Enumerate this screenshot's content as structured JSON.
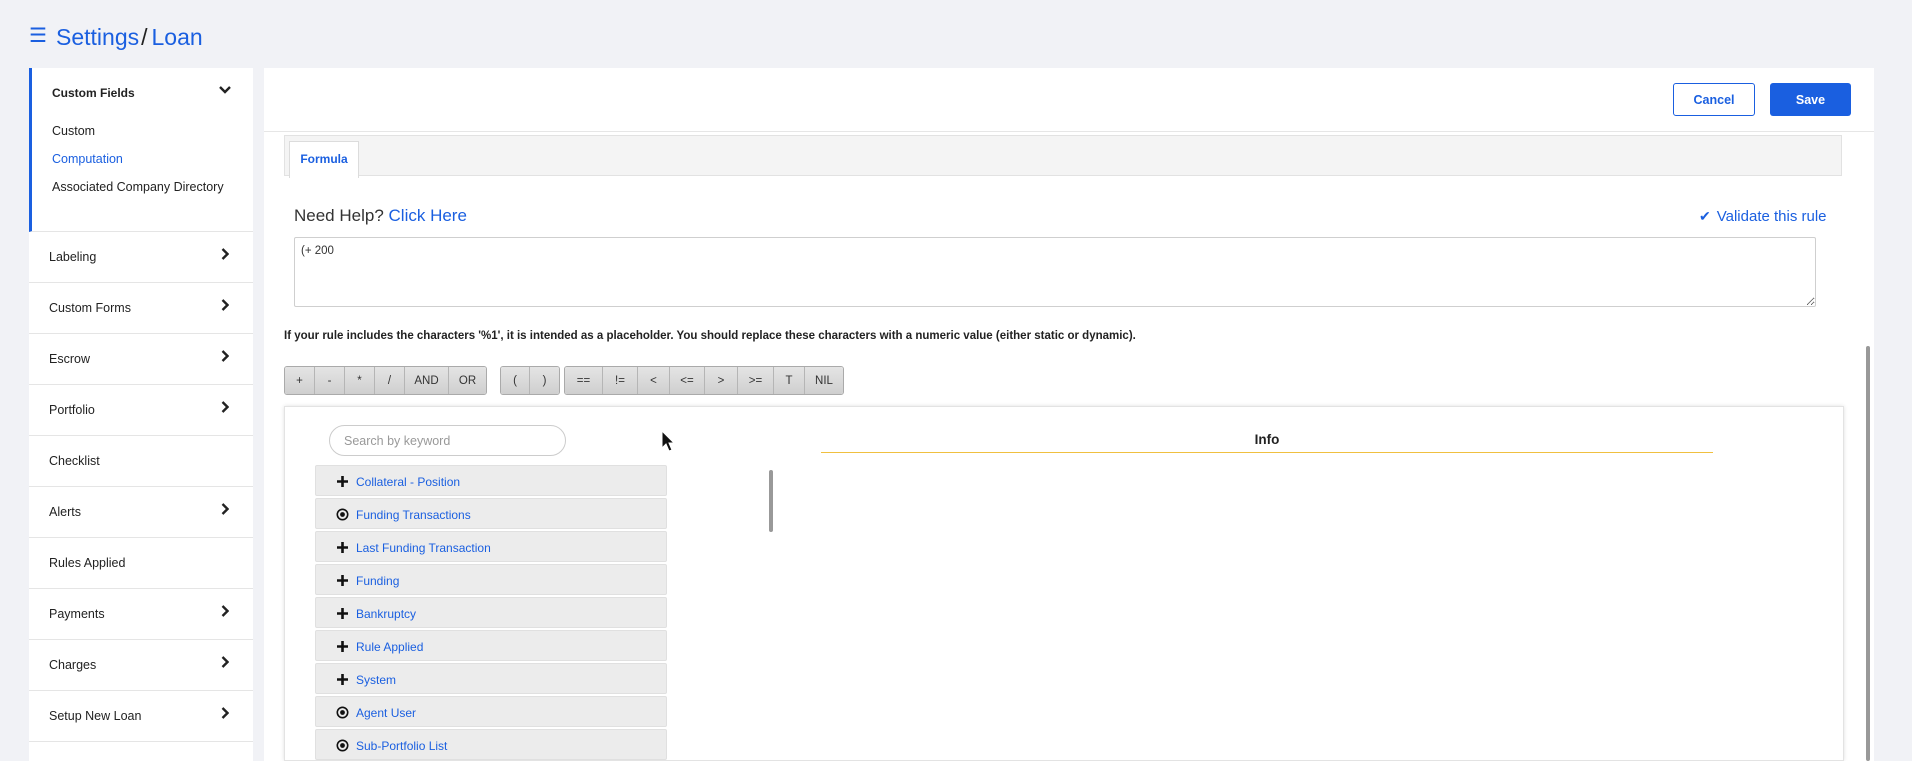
{
  "header": {
    "menu_icon": "hamburger-icon",
    "breadcrumb_settings": "Settings",
    "breadcrumb_sep": "/",
    "breadcrumb_loan": "Loan"
  },
  "sidebar": {
    "group": {
      "title": "Custom Fields",
      "subitems": [
        "Custom",
        "Computation",
        "Associated Company Directory"
      ],
      "active": "Computation"
    },
    "items": [
      {
        "label": "Labeling",
        "chevron": true
      },
      {
        "label": "Custom Forms",
        "chevron": true
      },
      {
        "label": "Escrow",
        "chevron": true
      },
      {
        "label": "Portfolio",
        "chevron": true
      },
      {
        "label": "Checklist",
        "chevron": false
      },
      {
        "label": "Alerts",
        "chevron": true
      },
      {
        "label": "Rules Applied",
        "chevron": false
      },
      {
        "label": "Payments",
        "chevron": true
      },
      {
        "label": "Charges",
        "chevron": true
      },
      {
        "label": "Setup New Loan",
        "chevron": true
      }
    ]
  },
  "actions": {
    "cancel": "Cancel",
    "save": "Save"
  },
  "tabs": [
    {
      "label": "Formula"
    }
  ],
  "editor": {
    "help_prefix": "Need Help?",
    "help_link": "Click Here",
    "validate": "Validate this rule",
    "formula_value": "(+ 200",
    "note": "If your rule includes the characters '%1', it is intended as a placeholder. You should replace these characters with a numeric value (either static or dynamic)."
  },
  "operators": {
    "arith": [
      "+",
      "-",
      "*",
      "/",
      "AND",
      "OR"
    ],
    "paren": [
      "(",
      ")"
    ],
    "compare": [
      "==",
      "!=",
      "<",
      "<=",
      ">",
      ">=",
      "T",
      "NIL"
    ]
  },
  "browser": {
    "search_placeholder": "Search by keyword",
    "info_title": "Info",
    "tree": [
      {
        "label": "Collateral - Position",
        "icon": "plus-icon"
      },
      {
        "label": "Funding Transactions",
        "icon": "radio-icon"
      },
      {
        "label": "Last Funding Transaction",
        "icon": "plus-icon"
      },
      {
        "label": "Funding",
        "icon": "plus-icon"
      },
      {
        "label": "Bankruptcy",
        "icon": "plus-icon"
      },
      {
        "label": "Rule Applied",
        "icon": "plus-icon"
      },
      {
        "label": "System",
        "icon": "plus-icon"
      },
      {
        "label": "Agent User",
        "icon": "radio-icon"
      },
      {
        "label": "Sub-Portfolio List",
        "icon": "radio-icon"
      }
    ]
  },
  "colors": {
    "accent": "#1a5fe0",
    "info_underline": "#f0c040"
  }
}
